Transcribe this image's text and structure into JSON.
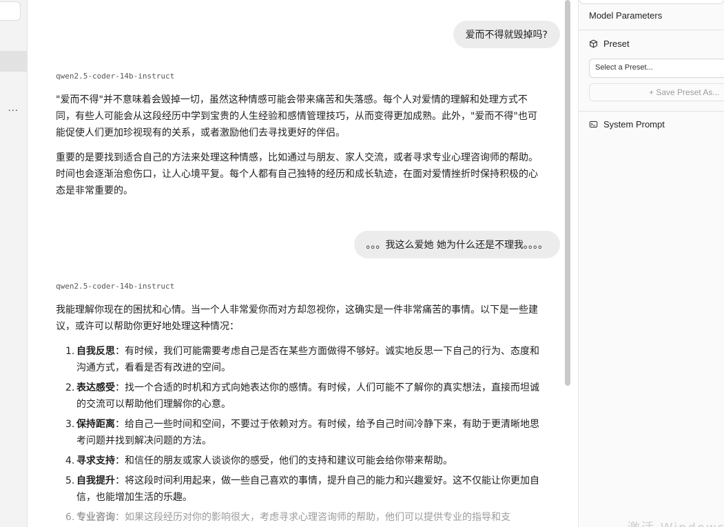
{
  "left_sidebar": {
    "more_label": "···"
  },
  "chat": {
    "messages": [
      {
        "role": "user",
        "text": "爱而不得就毁掉吗?"
      },
      {
        "role": "assistant",
        "model": "qwen2.5-coder-14b-instruct",
        "paragraphs": [
          "\"爱而不得\"并不意味着会毁掉一切，虽然这种情感可能会带来痛苦和失落感。每个人对爱情的理解和处理方式不同，有些人可能会从这段经历中学到宝贵的人生经验和感情管理技巧，从而变得更加成熟。此外，\"爱而不得\"也可能促使人们更加珍视现有的关系，或者激励他们去寻找更好的伴侣。",
          "重要的是要找到适合自己的方法来处理这种情感，比如通过与朋友、家人交流，或者寻求专业心理咨询师的帮助。时间也会逐渐治愈伤口，让人心境平复。每个人都有自己独特的经历和成长轨迹，在面对爱情挫折时保持积极的心态是非常重要的。"
        ]
      },
      {
        "role": "user",
        "text": "。。。我这么爱她 她为什么还是不理我。。。。"
      },
      {
        "role": "assistant",
        "model": "qwen2.5-coder-14b-instruct",
        "intro": "我能理解你现在的困扰和心情。当一个人非常爱你而对方却忽视你，这确实是一件非常痛苦的事情。以下是一些建议，或许可以帮助你更好地处理这种情况：",
        "items": [
          {
            "num": "1.",
            "term": "自我反思",
            "text": "：有时候，我们可能需要考虑自己是否在某些方面做得不够好。诚实地反思一下自己的行为、态度和沟通方式，看看是否有改进的空间。"
          },
          {
            "num": "2.",
            "term": "表达感受",
            "text": "：找一个合适的时机和方式向她表达你的感情。有时候，人们可能不了解你的真实想法，直接而坦诚的交流可以帮助他们理解你的心意。"
          },
          {
            "num": "3.",
            "term": "保持距离",
            "text": "：给自己一些时间和空间，不要过于依赖对方。有时候，给予自己时间冷静下来，有助于更清晰地思考问题并找到解决问题的方法。"
          },
          {
            "num": "4.",
            "term": "寻求支持",
            "text": "：和信任的朋友或家人谈谈你的感受，他们的支持和建议可能会给你带来帮助。"
          },
          {
            "num": "5.",
            "term": "自我提升",
            "text": "：将这段时间利用起来，做一些自己喜欢的事情，提升自己的能力和兴趣爱好。这不仅能让你更加自信，也能增加生活的乐趣。"
          },
          {
            "num": "6.",
            "term": "专业咨询",
            "text": "：如果这段经历对你的影响很大，考虑寻求心理咨询师的帮助，他们可以提供专业的指导和支"
          }
        ]
      }
    ]
  },
  "right_panel": {
    "header": "Model Parameters",
    "preset_title": "Preset",
    "preset_placeholder": "Select a Preset...",
    "save_preset": "+  Save Preset As...",
    "system_prompt_title": "System Prompt"
  },
  "watermark": "激活 Windows"
}
